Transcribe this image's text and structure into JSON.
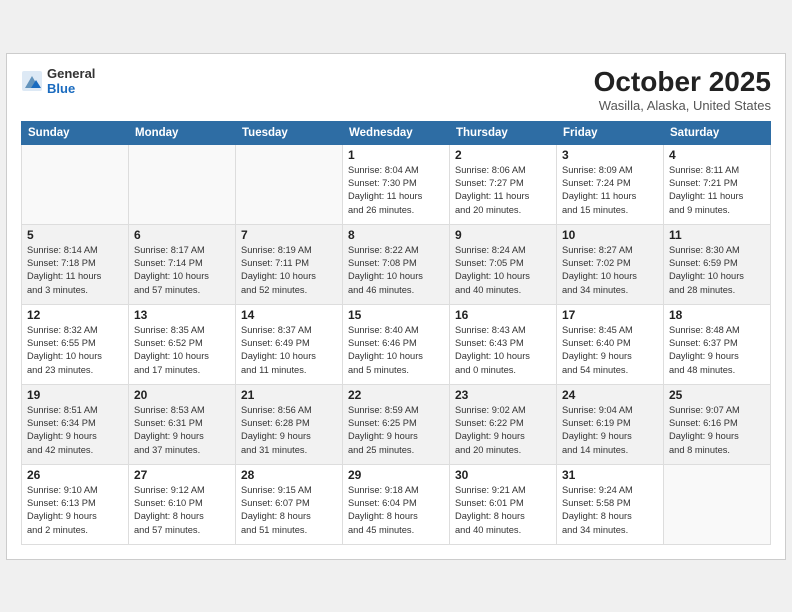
{
  "header": {
    "logo_general": "General",
    "logo_blue": "Blue",
    "month_title": "October 2025",
    "subtitle": "Wasilla, Alaska, United States"
  },
  "weekdays": [
    "Sunday",
    "Monday",
    "Tuesday",
    "Wednesday",
    "Thursday",
    "Friday",
    "Saturday"
  ],
  "weeks": [
    [
      {
        "day": "",
        "info": ""
      },
      {
        "day": "",
        "info": ""
      },
      {
        "day": "",
        "info": ""
      },
      {
        "day": "1",
        "info": "Sunrise: 8:04 AM\nSunset: 7:30 PM\nDaylight: 11 hours\nand 26 minutes."
      },
      {
        "day": "2",
        "info": "Sunrise: 8:06 AM\nSunset: 7:27 PM\nDaylight: 11 hours\nand 20 minutes."
      },
      {
        "day": "3",
        "info": "Sunrise: 8:09 AM\nSunset: 7:24 PM\nDaylight: 11 hours\nand 15 minutes."
      },
      {
        "day": "4",
        "info": "Sunrise: 8:11 AM\nSunset: 7:21 PM\nDaylight: 11 hours\nand 9 minutes."
      }
    ],
    [
      {
        "day": "5",
        "info": "Sunrise: 8:14 AM\nSunset: 7:18 PM\nDaylight: 11 hours\nand 3 minutes."
      },
      {
        "day": "6",
        "info": "Sunrise: 8:17 AM\nSunset: 7:14 PM\nDaylight: 10 hours\nand 57 minutes."
      },
      {
        "day": "7",
        "info": "Sunrise: 8:19 AM\nSunset: 7:11 PM\nDaylight: 10 hours\nand 52 minutes."
      },
      {
        "day": "8",
        "info": "Sunrise: 8:22 AM\nSunset: 7:08 PM\nDaylight: 10 hours\nand 46 minutes."
      },
      {
        "day": "9",
        "info": "Sunrise: 8:24 AM\nSunset: 7:05 PM\nDaylight: 10 hours\nand 40 minutes."
      },
      {
        "day": "10",
        "info": "Sunrise: 8:27 AM\nSunset: 7:02 PM\nDaylight: 10 hours\nand 34 minutes."
      },
      {
        "day": "11",
        "info": "Sunrise: 8:30 AM\nSunset: 6:59 PM\nDaylight: 10 hours\nand 28 minutes."
      }
    ],
    [
      {
        "day": "12",
        "info": "Sunrise: 8:32 AM\nSunset: 6:55 PM\nDaylight: 10 hours\nand 23 minutes."
      },
      {
        "day": "13",
        "info": "Sunrise: 8:35 AM\nSunset: 6:52 PM\nDaylight: 10 hours\nand 17 minutes."
      },
      {
        "day": "14",
        "info": "Sunrise: 8:37 AM\nSunset: 6:49 PM\nDaylight: 10 hours\nand 11 minutes."
      },
      {
        "day": "15",
        "info": "Sunrise: 8:40 AM\nSunset: 6:46 PM\nDaylight: 10 hours\nand 5 minutes."
      },
      {
        "day": "16",
        "info": "Sunrise: 8:43 AM\nSunset: 6:43 PM\nDaylight: 10 hours\nand 0 minutes."
      },
      {
        "day": "17",
        "info": "Sunrise: 8:45 AM\nSunset: 6:40 PM\nDaylight: 9 hours\nand 54 minutes."
      },
      {
        "day": "18",
        "info": "Sunrise: 8:48 AM\nSunset: 6:37 PM\nDaylight: 9 hours\nand 48 minutes."
      }
    ],
    [
      {
        "day": "19",
        "info": "Sunrise: 8:51 AM\nSunset: 6:34 PM\nDaylight: 9 hours\nand 42 minutes."
      },
      {
        "day": "20",
        "info": "Sunrise: 8:53 AM\nSunset: 6:31 PM\nDaylight: 9 hours\nand 37 minutes."
      },
      {
        "day": "21",
        "info": "Sunrise: 8:56 AM\nSunset: 6:28 PM\nDaylight: 9 hours\nand 31 minutes."
      },
      {
        "day": "22",
        "info": "Sunrise: 8:59 AM\nSunset: 6:25 PM\nDaylight: 9 hours\nand 25 minutes."
      },
      {
        "day": "23",
        "info": "Sunrise: 9:02 AM\nSunset: 6:22 PM\nDaylight: 9 hours\nand 20 minutes."
      },
      {
        "day": "24",
        "info": "Sunrise: 9:04 AM\nSunset: 6:19 PM\nDaylight: 9 hours\nand 14 minutes."
      },
      {
        "day": "25",
        "info": "Sunrise: 9:07 AM\nSunset: 6:16 PM\nDaylight: 9 hours\nand 8 minutes."
      }
    ],
    [
      {
        "day": "26",
        "info": "Sunrise: 9:10 AM\nSunset: 6:13 PM\nDaylight: 9 hours\nand 2 minutes."
      },
      {
        "day": "27",
        "info": "Sunrise: 9:12 AM\nSunset: 6:10 PM\nDaylight: 8 hours\nand 57 minutes."
      },
      {
        "day": "28",
        "info": "Sunrise: 9:15 AM\nSunset: 6:07 PM\nDaylight: 8 hours\nand 51 minutes."
      },
      {
        "day": "29",
        "info": "Sunrise: 9:18 AM\nSunset: 6:04 PM\nDaylight: 8 hours\nand 45 minutes."
      },
      {
        "day": "30",
        "info": "Sunrise: 9:21 AM\nSunset: 6:01 PM\nDaylight: 8 hours\nand 40 minutes."
      },
      {
        "day": "31",
        "info": "Sunrise: 9:24 AM\nSunset: 5:58 PM\nDaylight: 8 hours\nand 34 minutes."
      },
      {
        "day": "",
        "info": ""
      }
    ]
  ],
  "colors": {
    "header_bg": "#2e6da4",
    "accent_blue": "#1a6bbf"
  }
}
